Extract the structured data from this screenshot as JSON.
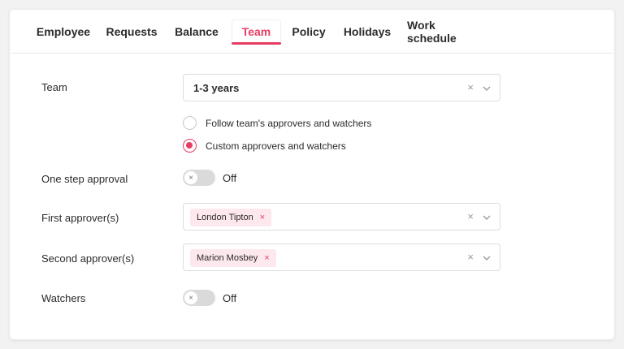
{
  "tabs": [
    {
      "label": "Employee"
    },
    {
      "label": "Requests"
    },
    {
      "label": "Balance"
    },
    {
      "label": "Team"
    },
    {
      "label": "Policy"
    },
    {
      "label": "Holidays"
    },
    {
      "label": "Work schedule"
    }
  ],
  "active_tab": "Team",
  "accent_color": "#e73d63",
  "form": {
    "team": {
      "label": "Team",
      "value": "1-3 years",
      "clear": "×"
    },
    "approver_mode": {
      "options": [
        {
          "label": "Follow team's approvers and watchers",
          "checked": false
        },
        {
          "label": "Custom approvers and watchers",
          "checked": true
        }
      ]
    },
    "one_step": {
      "label": "One step approval",
      "state": "Off",
      "knob": "×"
    },
    "first_approvers": {
      "label": "First approver(s)",
      "chip": "London Tipton",
      "chip_x": "×",
      "clear": "×"
    },
    "second_approvers": {
      "label": "Second approver(s)",
      "chip": "Marion Mosbey",
      "chip_x": "×",
      "clear": "×"
    },
    "watchers": {
      "label": "Watchers",
      "state": "Off",
      "knob": "×"
    }
  }
}
